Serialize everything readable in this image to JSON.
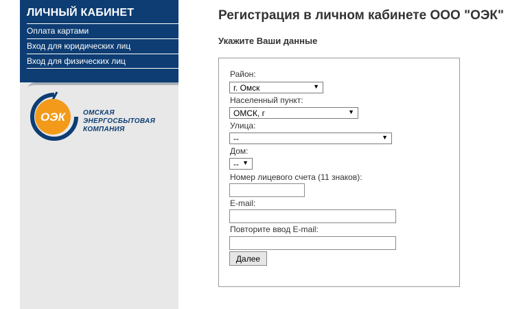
{
  "sidebar": {
    "title": "ЛИЧНЫЙ КАБИНЕТ",
    "links": [
      "Оплата картами",
      "Вход для юридических лиц",
      "Вход для физических лиц"
    ],
    "logo_text": "ОЭК",
    "company_name": "ОМСКАЯ ЭНЕРГОСБЫТОВАЯ КОМПАНИЯ"
  },
  "main": {
    "title": "Регистрация в личном кабинете ООО \"ОЭК\"",
    "subtitle": "Укажите Ваши данные"
  },
  "form": {
    "district_label": "Район:",
    "district_value": "г. Омск",
    "locality_label": "Населенный пункт:",
    "locality_value": "ОМСК, г",
    "street_label": "Улица:",
    "street_value": "--",
    "house_label": "Дом:",
    "house_value": "--",
    "account_label": "Номер лицевого счета (11 знаков):",
    "account_value": "",
    "email_label": "E-mail:",
    "email_value": "",
    "email_repeat_label": "Повторите ввод E-mail:",
    "email_repeat_value": "",
    "submit_label": "Далее"
  },
  "colors": {
    "sidebar_blue": "#0d3d73",
    "logo_orange": "#f39a1a"
  }
}
